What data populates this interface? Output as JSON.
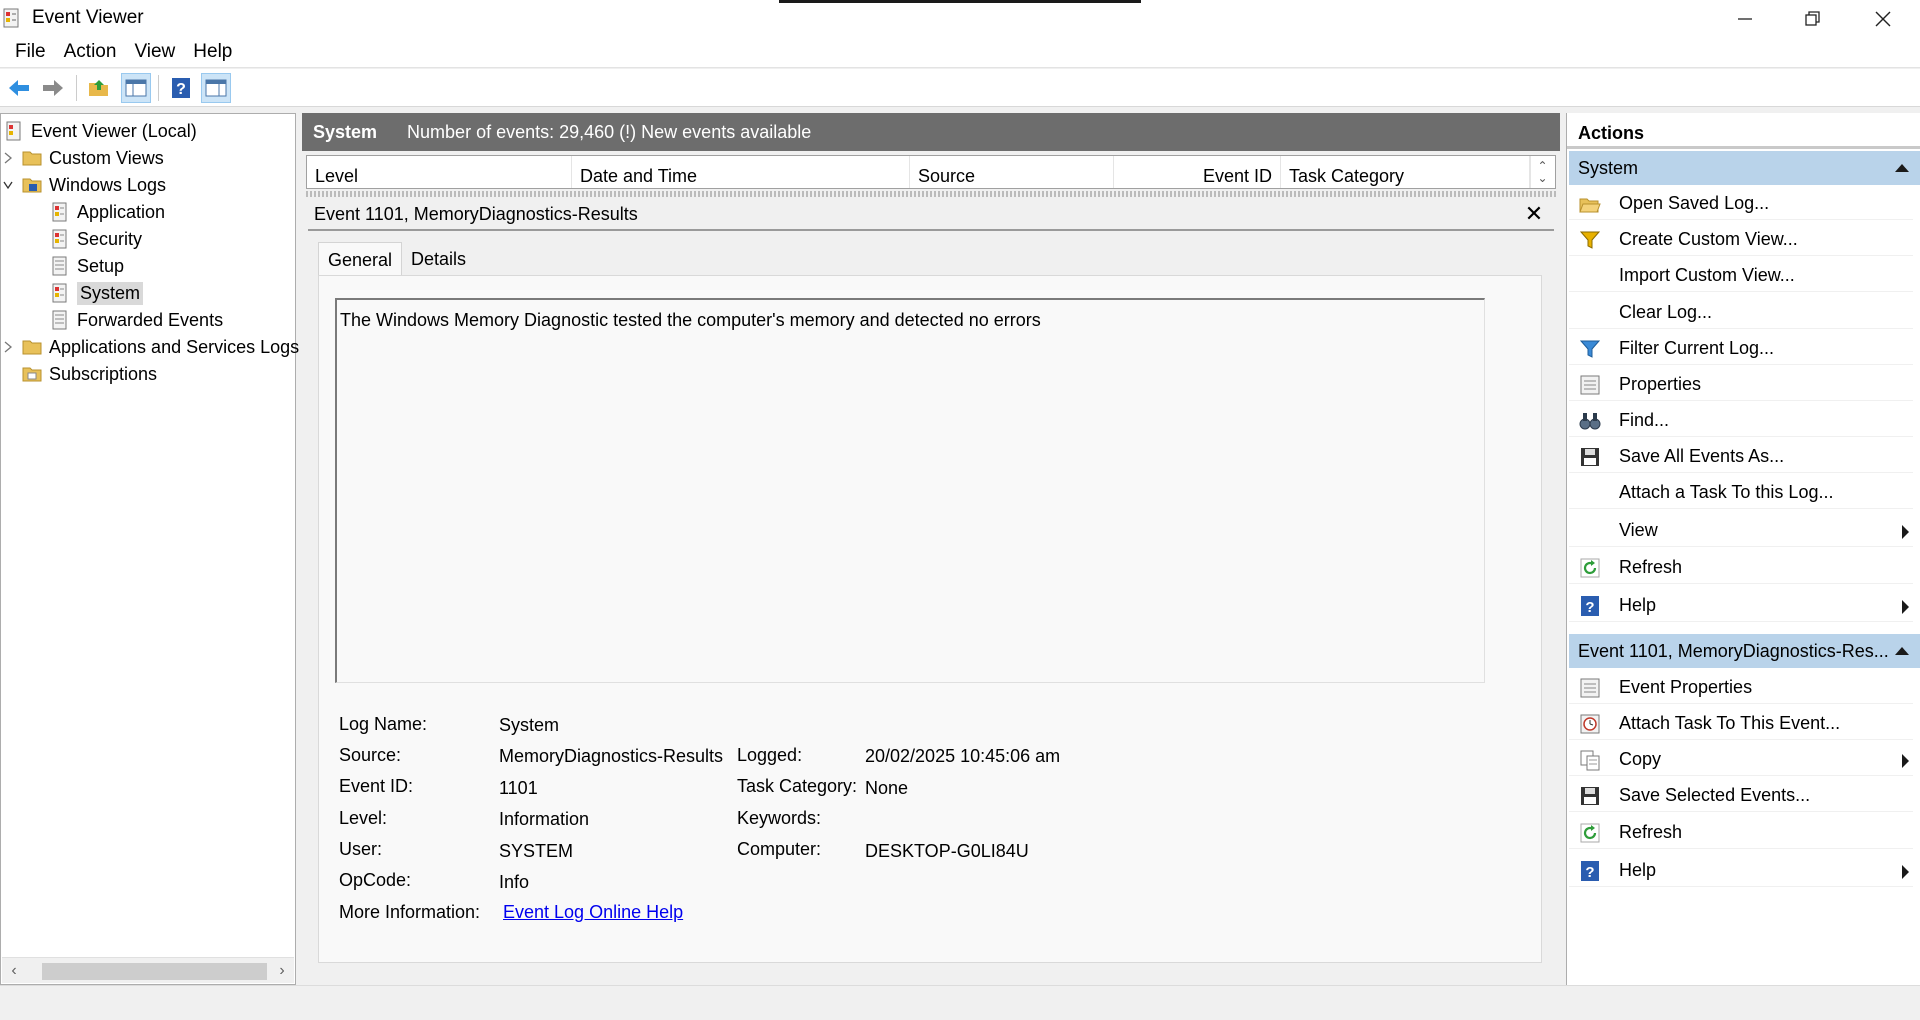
{
  "window": {
    "title": "Event Viewer",
    "controls": [
      "minimize-icon",
      "restore-icon",
      "close-icon"
    ]
  },
  "menu": [
    "File",
    "Action",
    "View",
    "Help"
  ],
  "toolbar": {
    "icons": [
      "back-arrow-icon",
      "forward-arrow-icon",
      "open-folder-icon",
      "show-hide-console-tree-icon",
      "help-icon",
      "show-hide-action-pane-icon"
    ]
  },
  "tree": {
    "root": "Event Viewer (Local)",
    "custom_views": "Custom Views",
    "windows_logs": "Windows Logs",
    "application": "Application",
    "security": "Security",
    "setup": "Setup",
    "system": "System",
    "forwarded_events": "Forwarded Events",
    "apps_services": "Applications and Services Logs",
    "subscriptions": "Subscriptions"
  },
  "center": {
    "log_name": "System",
    "summary": "Number of events: 29,460 (!) New events available",
    "columns": [
      "Level",
      "Date and Time",
      "Source",
      "Event ID",
      "Task Category"
    ],
    "detail_title": "Event 1101, MemoryDiagnostics-Results",
    "tabs": [
      "General",
      "Details"
    ],
    "description": "The Windows Memory Diagnostic tested the computer's memory and detected no errors",
    "props": {
      "log_name_label": "Log Name:",
      "log_name_value": "System",
      "source_label": "Source:",
      "source_value": "MemoryDiagnostics-Results",
      "logged_label": "Logged:",
      "logged_value": "20/02/2025 10:45:06 am",
      "event_id_label": "Event ID:",
      "event_id_value": "1101",
      "task_category_label": "Task Category:",
      "task_category_value": "None",
      "level_label": "Level:",
      "level_value": "Information",
      "keywords_label": "Keywords:",
      "keywords_value": "",
      "user_label": "User:",
      "user_value": "SYSTEM",
      "computer_label": "Computer:",
      "computer_value": "DESKTOP-G0LI84U",
      "opcode_label": "OpCode:",
      "opcode_value": "Info",
      "more_info_label": "More Information:",
      "more_info_link": "Event Log Online Help"
    }
  },
  "actions": {
    "title": "Actions",
    "section1": "System",
    "items1": [
      {
        "label": "Open Saved Log...",
        "icon": "open-folder-icon"
      },
      {
        "label": "Create Custom View...",
        "icon": "funnel-icon"
      },
      {
        "label": "Import Custom View...",
        "icon": ""
      },
      {
        "label": "Clear Log...",
        "icon": ""
      },
      {
        "label": "Filter Current Log...",
        "icon": "funnel-icon"
      },
      {
        "label": "Properties",
        "icon": "properties-icon"
      },
      {
        "label": "Find...",
        "icon": "binoculars-icon"
      },
      {
        "label": "Save All Events As...",
        "icon": "floppy-disk-icon"
      },
      {
        "label": "Attach a Task To this Log...",
        "icon": ""
      },
      {
        "label": "View",
        "icon": ""
      },
      {
        "label": "Refresh",
        "icon": "refresh-icon"
      },
      {
        "label": "Help",
        "icon": "help-icon"
      }
    ],
    "section2": "Event 1101, MemoryDiagnostics-Res...",
    "items2": [
      {
        "label": "Event Properties",
        "icon": "properties-icon"
      },
      {
        "label": "Attach Task To This Event...",
        "icon": "clock-task-icon"
      },
      {
        "label": "Copy",
        "icon": "copy-icon"
      },
      {
        "label": "Save Selected Events...",
        "icon": "floppy-disk-icon"
      },
      {
        "label": "Refresh",
        "icon": "refresh-icon"
      },
      {
        "label": "Help",
        "icon": "help-icon"
      }
    ]
  },
  "colors": {
    "header_bg": "#6d6d6d",
    "section_bg": "#b9d3ea",
    "link": "#0000ee",
    "selected_tree": "#d9d9d9"
  }
}
